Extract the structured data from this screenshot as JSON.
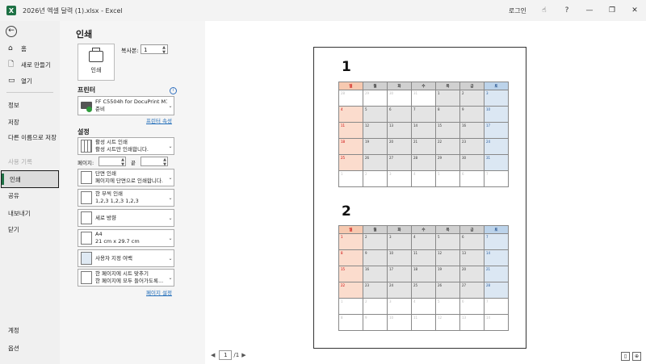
{
  "window": {
    "title": "2026년 엑셀 달력 (1).xlsx  -  Excel",
    "app_icon": "X",
    "login": "로그인",
    "help": "?",
    "controls": [
      "—",
      "❐",
      "✕"
    ]
  },
  "sidebar": {
    "items": [
      {
        "label": "홈",
        "icon": "home-icon"
      },
      {
        "label": "새로 만들기",
        "icon": "new-document-icon"
      },
      {
        "label": "열기",
        "icon": "folder-icon"
      },
      {
        "label": "정보"
      },
      {
        "label": "저장"
      },
      {
        "label": "다른 이름으로 저장"
      },
      {
        "label": "사용 기록"
      },
      {
        "label": "인쇄"
      },
      {
        "label": "공유"
      },
      {
        "label": "내보내기"
      },
      {
        "label": "닫기"
      },
      {
        "label": "계정"
      },
      {
        "label": "옵션"
      }
    ]
  },
  "print": {
    "heading": "인쇄",
    "print_button": "인쇄",
    "copies_label": "복사본:",
    "copies_value": "1",
    "printer_heading": "프린터",
    "printer_name": "FF C5504h for DocuPrint M11...",
    "printer_status": "준비",
    "printer_properties": "프린터 속성",
    "settings_heading": "설정",
    "settings": [
      {
        "line1": "활성 시트 인쇄",
        "line2": "활성 시트만 인쇄합니다."
      },
      {
        "line1": "단면 인쇄",
        "line2": "페이지에 단면으로 인쇄합니다."
      },
      {
        "line1": "한 부씩 인쇄",
        "line2": "1,2,3    1,2,3    1,2,3"
      },
      {
        "line1": "세로 방향",
        "line2": ""
      },
      {
        "line1": "A4",
        "line2": "21 cm x 29.7 cm"
      },
      {
        "line1": "사용자 지정 여백",
        "line2": ""
      },
      {
        "line1": "한 페이지에 시트 맞추기",
        "line2": "한 페이지에 모두 들어가도록..."
      }
    ],
    "pages_label": "페이지:",
    "to_label": "끝",
    "page_setup": "페이지 설정"
  },
  "preview": {
    "current_page": "1",
    "total_pages": "/1",
    "weekdays": [
      "일",
      "월",
      "화",
      "수",
      "목",
      "금",
      "토"
    ],
    "months": [
      {
        "label": "1",
        "weeks": [
          [
            {
              "d": "28",
              "o": true
            },
            {
              "d": "29",
              "o": true
            },
            {
              "d": "30",
              "o": true
            },
            {
              "d": "31",
              "o": true
            },
            {
              "d": "1"
            },
            {
              "d": "2"
            },
            {
              "d": "3"
            }
          ],
          [
            {
              "d": "4"
            },
            {
              "d": "5"
            },
            {
              "d": "6"
            },
            {
              "d": "7"
            },
            {
              "d": "8"
            },
            {
              "d": "9"
            },
            {
              "d": "10"
            }
          ],
          [
            {
              "d": "11"
            },
            {
              "d": "12"
            },
            {
              "d": "13"
            },
            {
              "d": "14"
            },
            {
              "d": "15"
            },
            {
              "d": "16"
            },
            {
              "d": "17"
            }
          ],
          [
            {
              "d": "18"
            },
            {
              "d": "19"
            },
            {
              "d": "20"
            },
            {
              "d": "21"
            },
            {
              "d": "22"
            },
            {
              "d": "23"
            },
            {
              "d": "24"
            }
          ],
          [
            {
              "d": "25"
            },
            {
              "d": "26"
            },
            {
              "d": "27"
            },
            {
              "d": "28"
            },
            {
              "d": "29"
            },
            {
              "d": "30"
            },
            {
              "d": "31"
            }
          ],
          [
            {
              "d": "1",
              "o": true
            },
            {
              "d": "2",
              "o": true
            },
            {
              "d": "3",
              "o": true
            },
            {
              "d": "4",
              "o": true
            },
            {
              "d": "5",
              "o": true
            },
            {
              "d": "6",
              "o": true
            },
            {
              "d": "7",
              "o": true
            }
          ]
        ]
      },
      {
        "label": "2",
        "weeks": [
          [
            {
              "d": "1"
            },
            {
              "d": "2"
            },
            {
              "d": "3"
            },
            {
              "d": "4"
            },
            {
              "d": "5"
            },
            {
              "d": "6"
            },
            {
              "d": "7"
            }
          ],
          [
            {
              "d": "8"
            },
            {
              "d": "9"
            },
            {
              "d": "10"
            },
            {
              "d": "11"
            },
            {
              "d": "12"
            },
            {
              "d": "13"
            },
            {
              "d": "14"
            }
          ],
          [
            {
              "d": "15"
            },
            {
              "d": "16"
            },
            {
              "d": "17"
            },
            {
              "d": "18"
            },
            {
              "d": "19"
            },
            {
              "d": "20"
            },
            {
              "d": "21"
            }
          ],
          [
            {
              "d": "22"
            },
            {
              "d": "23"
            },
            {
              "d": "24"
            },
            {
              "d": "25"
            },
            {
              "d": "26"
            },
            {
              "d": "27"
            },
            {
              "d": "28"
            }
          ],
          [
            {
              "d": "1",
              "o": true
            },
            {
              "d": "2",
              "o": true
            },
            {
              "d": "3",
              "o": true
            },
            {
              "d": "4",
              "o": true
            },
            {
              "d": "5",
              "o": true
            },
            {
              "d": "6",
              "o": true
            },
            {
              "d": "7",
              "o": true
            }
          ],
          [
            {
              "d": "8",
              "o": true
            },
            {
              "d": "9",
              "o": true
            },
            {
              "d": "10",
              "o": true
            },
            {
              "d": "11",
              "o": true
            },
            {
              "d": "12",
              "o": true
            },
            {
              "d": "13",
              "o": true
            },
            {
              "d": "14",
              "o": true
            }
          ]
        ]
      }
    ]
  }
}
